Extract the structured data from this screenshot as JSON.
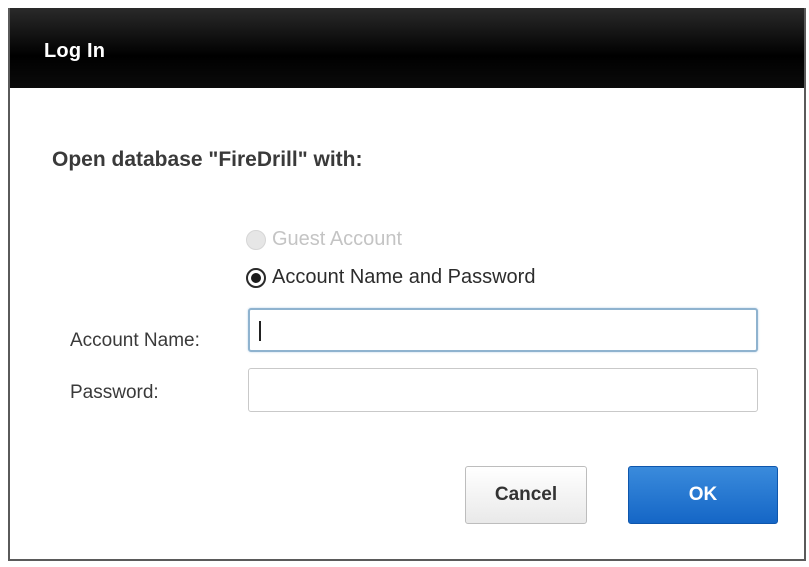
{
  "dialog": {
    "title": "Log In",
    "heading": "Open database \"FireDrill\" with:"
  },
  "options": {
    "guest_label": "Guest Account",
    "guest_enabled": false,
    "account_label": "Account Name and Password",
    "selected": "account"
  },
  "fields": {
    "account_name_label": "Account Name:",
    "account_name_value": "",
    "password_label": "Password:",
    "password_value": ""
  },
  "buttons": {
    "cancel_label": "Cancel",
    "ok_label": "OK"
  },
  "colors": {
    "title_bar": "#000000",
    "ok_button": "#1b6fd0",
    "focus_border": "#8fb3cf"
  }
}
